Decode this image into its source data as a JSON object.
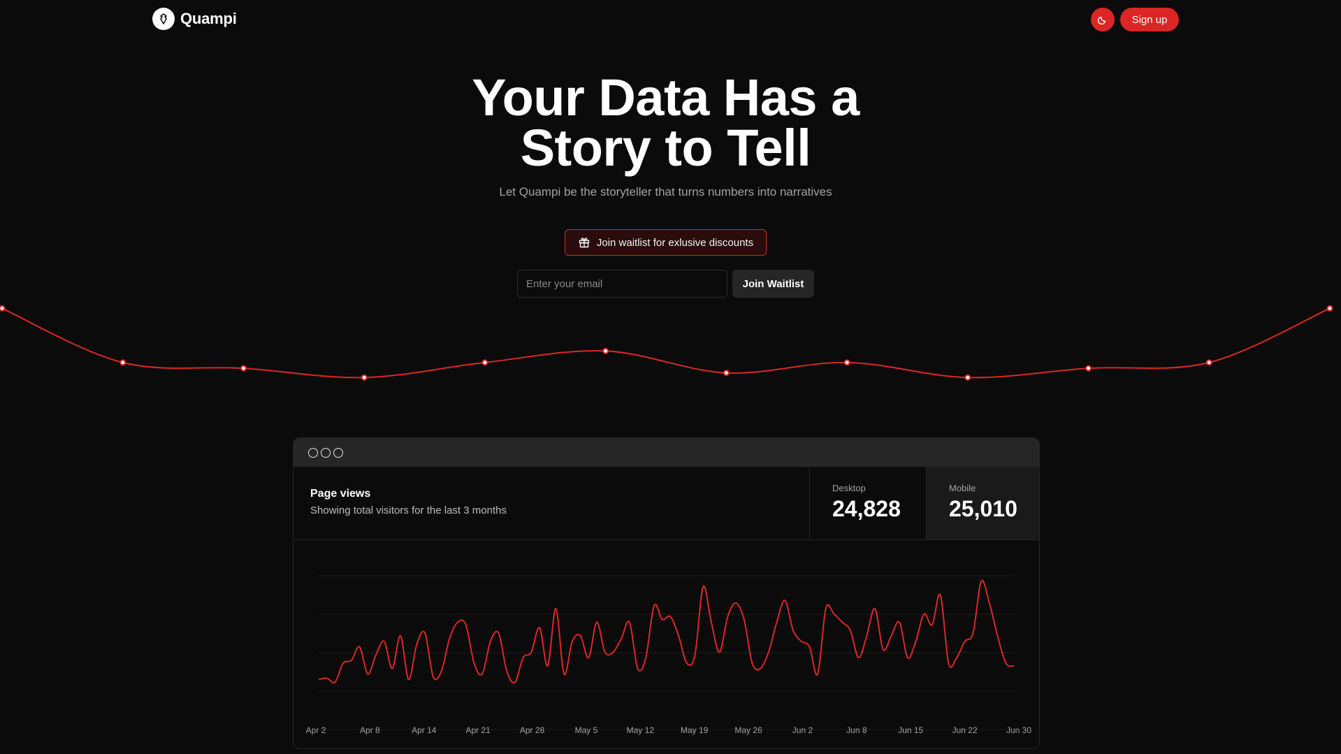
{
  "nav": {
    "brand": "Quampi",
    "theme_toggle": "moon-icon",
    "signup_label": "Sign up"
  },
  "hero": {
    "title_line1": "Your Data Has a",
    "title_line2": "Story to Tell",
    "subtitle": "Let Quampi be the storyteller that turns numbers into narratives",
    "badge_label": "Join waitlist for exlusive discounts",
    "email_placeholder": "Enter your email",
    "join_label": "Join Waitlist"
  },
  "card": {
    "title": "Page views",
    "subtitle": "Showing total visitors for the last 3 months",
    "desktop_label": "Desktop",
    "desktop_value": "24,828",
    "mobile_label": "Mobile",
    "mobile_value": "25,010"
  },
  "colors": {
    "accent": "#dc2626",
    "background": "#0c0b0b",
    "panel": "#262626"
  },
  "chart_data": [
    {
      "type": "line",
      "series": [
        {
          "values": [
            72,
            25,
            20,
            12,
            25,
            35,
            16,
            25,
            12,
            20,
            25,
            72
          ]
        }
      ]
    },
    {
      "type": "line",
      "x_ticks": [
        "Apr 2",
        "Apr 8",
        "Apr 14",
        "Apr 21",
        "Apr 28",
        "May 5",
        "May 12",
        "May 19",
        "May 26",
        "Jun 2",
        "Jun 8",
        "Jun 15",
        "Jun 22",
        "Jun 30"
      ],
      "series": [
        {
          "values": [
            40,
            45,
            30,
            100,
            110,
            160,
            60,
            130,
            180,
            80,
            200,
            40,
            170,
            210,
            50,
            70,
            190,
            250,
            240,
            100,
            60,
            180,
            210,
            70,
            30,
            120,
            140,
            230,
            90,
            300,
            60,
            180,
            200,
            120,
            250,
            140,
            140,
            190,
            250,
            80,
            120,
            310,
            260,
            270,
            200,
            100,
            130,
            380,
            250,
            140,
            270,
            320,
            260,
            100,
            80,
            140,
            250,
            330,
            220,
            180,
            160,
            60,
            300,
            280,
            250,
            220,
            120,
            200,
            300,
            150,
            200,
            250,
            120,
            180,
            280,
            240,
            350,
            100,
            120,
            180,
            210,
            400,
            320,
            200,
            100,
            90
          ]
        }
      ]
    }
  ]
}
